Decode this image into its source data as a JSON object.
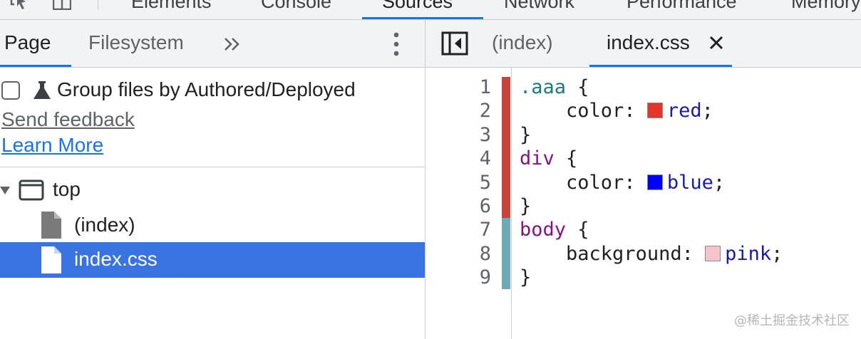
{
  "toolbar": {
    "tabs": [
      {
        "label": "Elements"
      },
      {
        "label": "Console"
      },
      {
        "label": "Sources"
      },
      {
        "label": "Network"
      },
      {
        "label": "Performance"
      },
      {
        "label": "Memory"
      }
    ],
    "active_tab": "Sources",
    "icons": [
      "inspect-element-icon",
      "device-toolbar-icon"
    ]
  },
  "navigator": {
    "tabs": [
      {
        "label": "Page"
      },
      {
        "label": "Filesystem"
      }
    ],
    "active_tab": "Page",
    "group_checkbox": {
      "label": "Group files by Authored/Deployed",
      "checked": false
    },
    "send_feedback": "Send feedback",
    "learn_more": "Learn More",
    "tree": [
      {
        "label": "top",
        "icon": "frame-icon",
        "expanded": true
      },
      {
        "label": "(index)",
        "icon": "document-icon"
      },
      {
        "label": "index.css",
        "icon": "document-icon",
        "selected": true
      }
    ]
  },
  "editor": {
    "tabs": [
      {
        "label": "(index)"
      },
      {
        "label": "index.css",
        "closable": true
      }
    ],
    "active_tab": "index.css",
    "line_numbers": [
      "1",
      "2",
      "3",
      "4",
      "5",
      "6",
      "7",
      "8",
      "9"
    ],
    "lines": [
      [
        {
          "t": ".aaa",
          "c": "sel"
        },
        {
          "t": " {",
          "c": "plain"
        }
      ],
      [
        {
          "t": "    ",
          "c": "plain"
        },
        {
          "t": "color",
          "c": "prop"
        },
        {
          "t": ": ",
          "c": "plain"
        },
        {
          "swatch": "#e5342a"
        },
        {
          "t": "red",
          "c": "val"
        },
        {
          "t": ";",
          "c": "plain"
        }
      ],
      [
        {
          "t": "}",
          "c": "plain"
        }
      ],
      [
        {
          "t": "div",
          "c": "tag"
        },
        {
          "t": " {",
          "c": "plain"
        }
      ],
      [
        {
          "t": "    ",
          "c": "plain"
        },
        {
          "t": "color",
          "c": "prop"
        },
        {
          "t": ": ",
          "c": "plain"
        },
        {
          "swatch": "#0000ff"
        },
        {
          "t": "blue",
          "c": "val"
        },
        {
          "t": ";",
          "c": "plain"
        }
      ],
      [
        {
          "t": "}",
          "c": "plain"
        }
      ],
      [
        {
          "t": "body",
          "c": "tag"
        },
        {
          "t": " {",
          "c": "plain"
        }
      ],
      [
        {
          "t": "    ",
          "c": "plain"
        },
        {
          "t": "background",
          "c": "prop"
        },
        {
          "t": ": ",
          "c": "plain"
        },
        {
          "swatch": "#f7c3cd"
        },
        {
          "t": "pink",
          "c": "val"
        },
        {
          "t": ";",
          "c": "plain"
        }
      ],
      [
        {
          "t": "}",
          "c": "plain"
        }
      ]
    ],
    "coverage": {
      "used_lines": "1-6",
      "unused_lines": "7-9",
      "used_color": "#c5443a",
      "unused_color": "#6fa8b6"
    }
  },
  "colors": {
    "accent": "#1a73e8",
    "selection": "#3873e0"
  },
  "watermark": "@稀土掘金技术社区"
}
